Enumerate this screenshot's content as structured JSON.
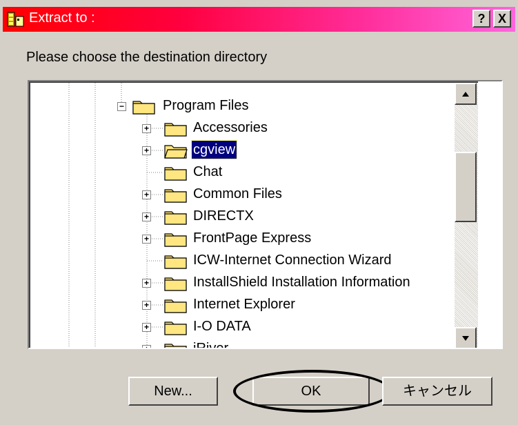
{
  "window": {
    "title": "Extract to :",
    "help_label": "?",
    "close_label": "X"
  },
  "prompt": "Please choose the destination directory",
  "tree": {
    "root": {
      "label": "Program Files",
      "expanded": true
    },
    "items": [
      {
        "label": "Accessories",
        "expandable": true,
        "selected": false
      },
      {
        "label": "cgview",
        "expandable": true,
        "selected": true
      },
      {
        "label": "Chat",
        "expandable": false,
        "selected": false
      },
      {
        "label": "Common Files",
        "expandable": true,
        "selected": false
      },
      {
        "label": "DIRECTX",
        "expandable": true,
        "selected": false
      },
      {
        "label": "FrontPage Express",
        "expandable": true,
        "selected": false
      },
      {
        "label": "ICW-Internet Connection Wizard",
        "expandable": false,
        "selected": false
      },
      {
        "label": "InstallShield Installation Information",
        "expandable": true,
        "selected": false
      },
      {
        "label": "Internet Explorer",
        "expandable": true,
        "selected": false
      },
      {
        "label": "I-O DATA",
        "expandable": true,
        "selected": false
      },
      {
        "label": "iRiver",
        "expandable": true,
        "selected": false
      }
    ]
  },
  "buttons": {
    "new": "New...",
    "ok": "OK",
    "cancel": "キャンセル"
  },
  "colors": {
    "face": "#d4d0c8",
    "selection": "#000080",
    "folder": "#ffe680"
  }
}
